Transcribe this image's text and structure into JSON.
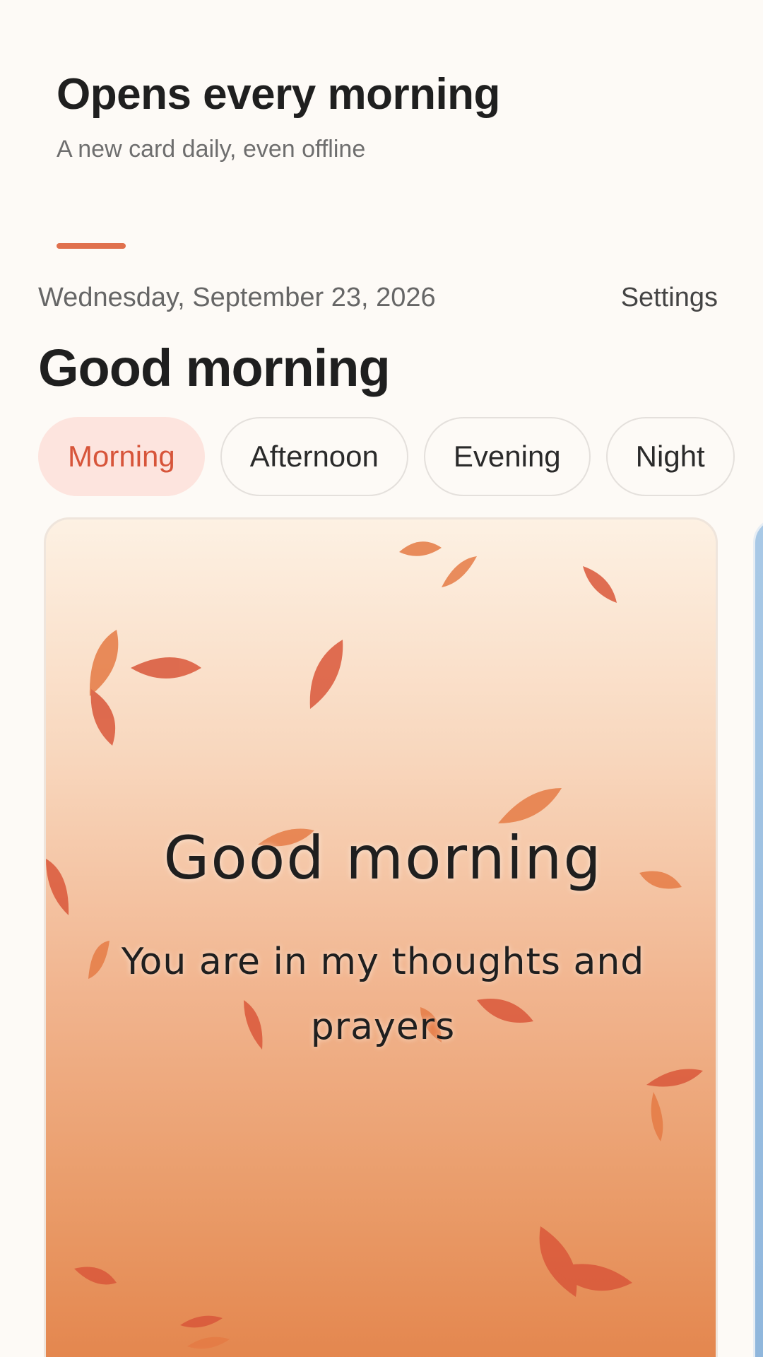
{
  "promo": {
    "title": "Opens every morning",
    "subtitle": "A new card daily, even offline"
  },
  "colors": {
    "accent": "#e0704d",
    "active_tab_bg": "#fde4de",
    "active_tab_text": "#d7553a",
    "leaf": "#d9573a"
  },
  "header": {
    "date": "Wednesday, September 23, 2026",
    "settings_label": "Settings",
    "greeting": "Good morning"
  },
  "tabs": [
    {
      "label": "Morning",
      "active": true
    },
    {
      "label": "Afternoon",
      "active": false
    },
    {
      "label": "Evening",
      "active": false
    },
    {
      "label": "Night",
      "active": false
    }
  ],
  "card": {
    "heading": "Good morning",
    "message": "You are in my thoughts and prayers",
    "theme": "autumn-leaves"
  }
}
